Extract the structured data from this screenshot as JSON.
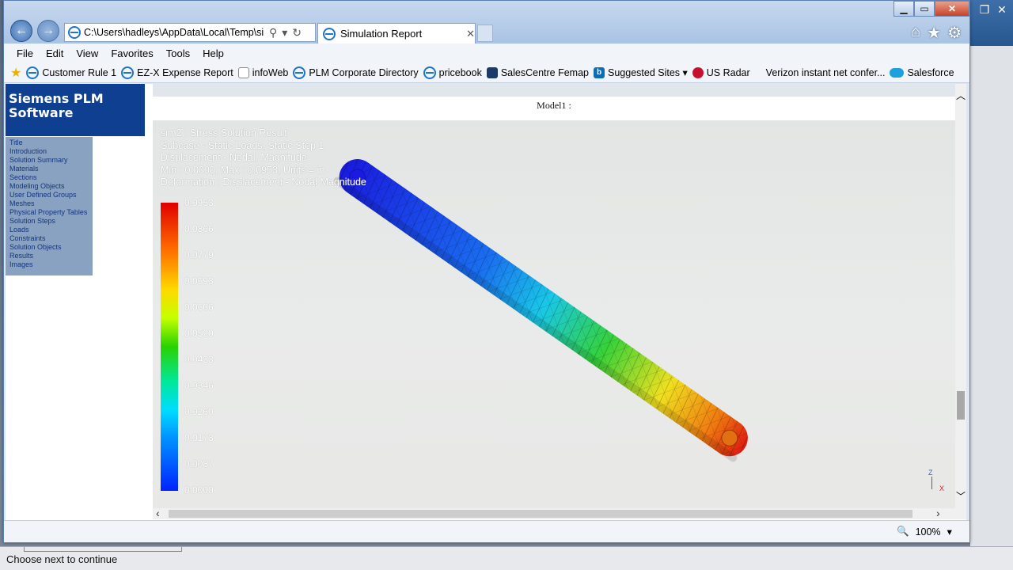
{
  "browser": {
    "address_url": "C:\\Users\\hadleys\\AppData\\Local\\Temp\\sim",
    "tab_title": "Simulation Report",
    "menu": [
      "File",
      "Edit",
      "View",
      "Favorites",
      "Tools",
      "Help"
    ],
    "favorites": [
      {
        "label": "Customer Rule 1",
        "icon": "ie-icon"
      },
      {
        "label": "EZ-X Expense Report",
        "icon": "ie-icon"
      },
      {
        "label": "infoWeb",
        "icon": "page-icon"
      },
      {
        "label": "PLM Corporate Directory",
        "icon": "ie-icon"
      },
      {
        "label": "pricebook",
        "icon": "ie-icon"
      },
      {
        "label": "SalesCentre Femap",
        "icon": "femap-icon"
      },
      {
        "label": "Suggested Sites ▾",
        "icon": "bing-icon"
      },
      {
        "label": "US Radar",
        "icon": "red-icon"
      },
      {
        "label": "Verizon instant net confer...",
        "icon": "none"
      },
      {
        "label": "Salesforce",
        "icon": "cloud-icon"
      }
    ],
    "zoom": "100%"
  },
  "toc": {
    "brand_line1": "Siemens PLM",
    "brand_line2": "Software",
    "items": [
      "Title",
      "Introduction",
      "Solution Summary",
      "Materials",
      "Sections",
      "Modeling Objects",
      "User Defined Groups",
      "Meshes",
      "Physical Property Tables",
      "Solution Steps",
      "Loads",
      "Constraints",
      "Solution Objects",
      "Results",
      "Images"
    ]
  },
  "report": {
    "model_title": "Model1 :",
    "info_lines": [
      "sim2 : Stress Solution Result",
      "Subcase - Static Loads, Static Step 1",
      "Displacement - Nodal, Magnitude",
      "Min : 0.0000, Max : 0.0953, Units = in",
      "Deformation : Displacement - Nodal Magnitude"
    ],
    "legend_values": [
      "0.0953",
      "0.0866",
      "0.0779",
      "0.0693",
      "0.0606",
      "0.0520",
      "0.0433",
      "0.0346",
      "0.0260",
      "0.0173",
      "0.0087",
      "0.0000"
    ],
    "triad_labels": [
      "Z",
      "X"
    ]
  },
  "status": {
    "message": "Choose next to continue"
  }
}
